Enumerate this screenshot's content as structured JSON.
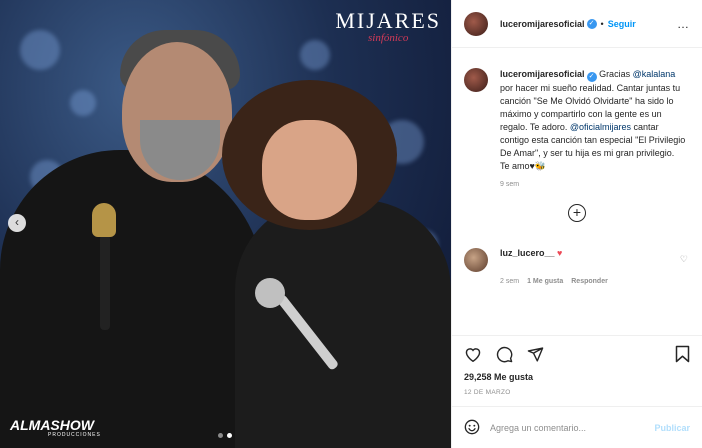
{
  "photo": {
    "logo_top_name": "MIJARES",
    "logo_top_sub": "sinfónico",
    "logo_bottom_name": "ALMASHOW",
    "logo_bottom_sub": "PRODUCCIONES",
    "carousel_index": 2,
    "carousel_total": 2
  },
  "header": {
    "username": "luceromijaresoficial",
    "separator": "•",
    "follow_label": "Seguir",
    "more_icon": "…"
  },
  "caption": {
    "username": "luceromijaresoficial",
    "part1": "Gracias ",
    "mention1": "@kalalana",
    "part2": " por hacer mi sueño realidad. Cantar juntas tu canción \"Se Me Olvidó Olvidarte\" ha sido lo máximo y compartirlo con la gente es un regalo. Te adoro. ",
    "mention2": "@oficialmijares",
    "part3": " cantar contigo esta canción tan especial \"El Privilegio De Amar\", y ser tu hija es mi gran privilegio. Te amo♥",
    "emoji": "🐝",
    "time": "9 sem"
  },
  "comment": {
    "username": "luz_lucero__",
    "heart": "♥",
    "time": "2 sem",
    "likes": "1 Me gusta",
    "reply": "Responder"
  },
  "actions": {
    "likes": "29,258 Me gusta",
    "date": "12 DE MARZO"
  },
  "add_comment": {
    "placeholder": "Agrega un comentario...",
    "post_label": "Publicar"
  },
  "colors": {
    "link_blue": "#0095f6",
    "mention_blue": "#00376b",
    "verified_blue": "#3897f0",
    "heart_red": "#ed4956",
    "muted_gray": "#8e8e8e"
  }
}
